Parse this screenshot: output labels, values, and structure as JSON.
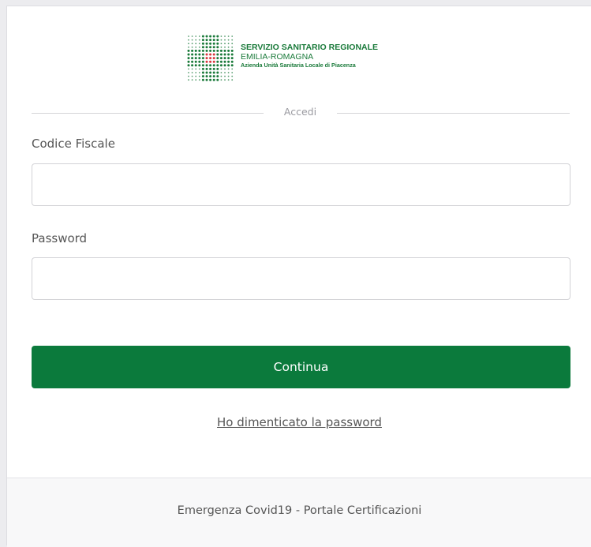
{
  "logo": {
    "line1": "SERVIZIO SANITARIO REGIONALE",
    "line2": "EMILIA-ROMAGNA",
    "line3": "Azienda Unità Sanitaria Locale di Piacenza"
  },
  "login": {
    "divider_label": "Accedi",
    "codice_fiscale_label": "Codice Fiscale",
    "codice_fiscale_value": "",
    "password_label": "Password",
    "password_value": "",
    "continue_label": "Continua",
    "forgot_password_label": "Ho dimenticato la password"
  },
  "footer": {
    "text": "Emergenza Covid19 - Portale Certificazioni"
  },
  "colors": {
    "brand_green": "#0b7a3c",
    "logo_green": "#1a7a3a",
    "logo_red": "#d9363e"
  }
}
